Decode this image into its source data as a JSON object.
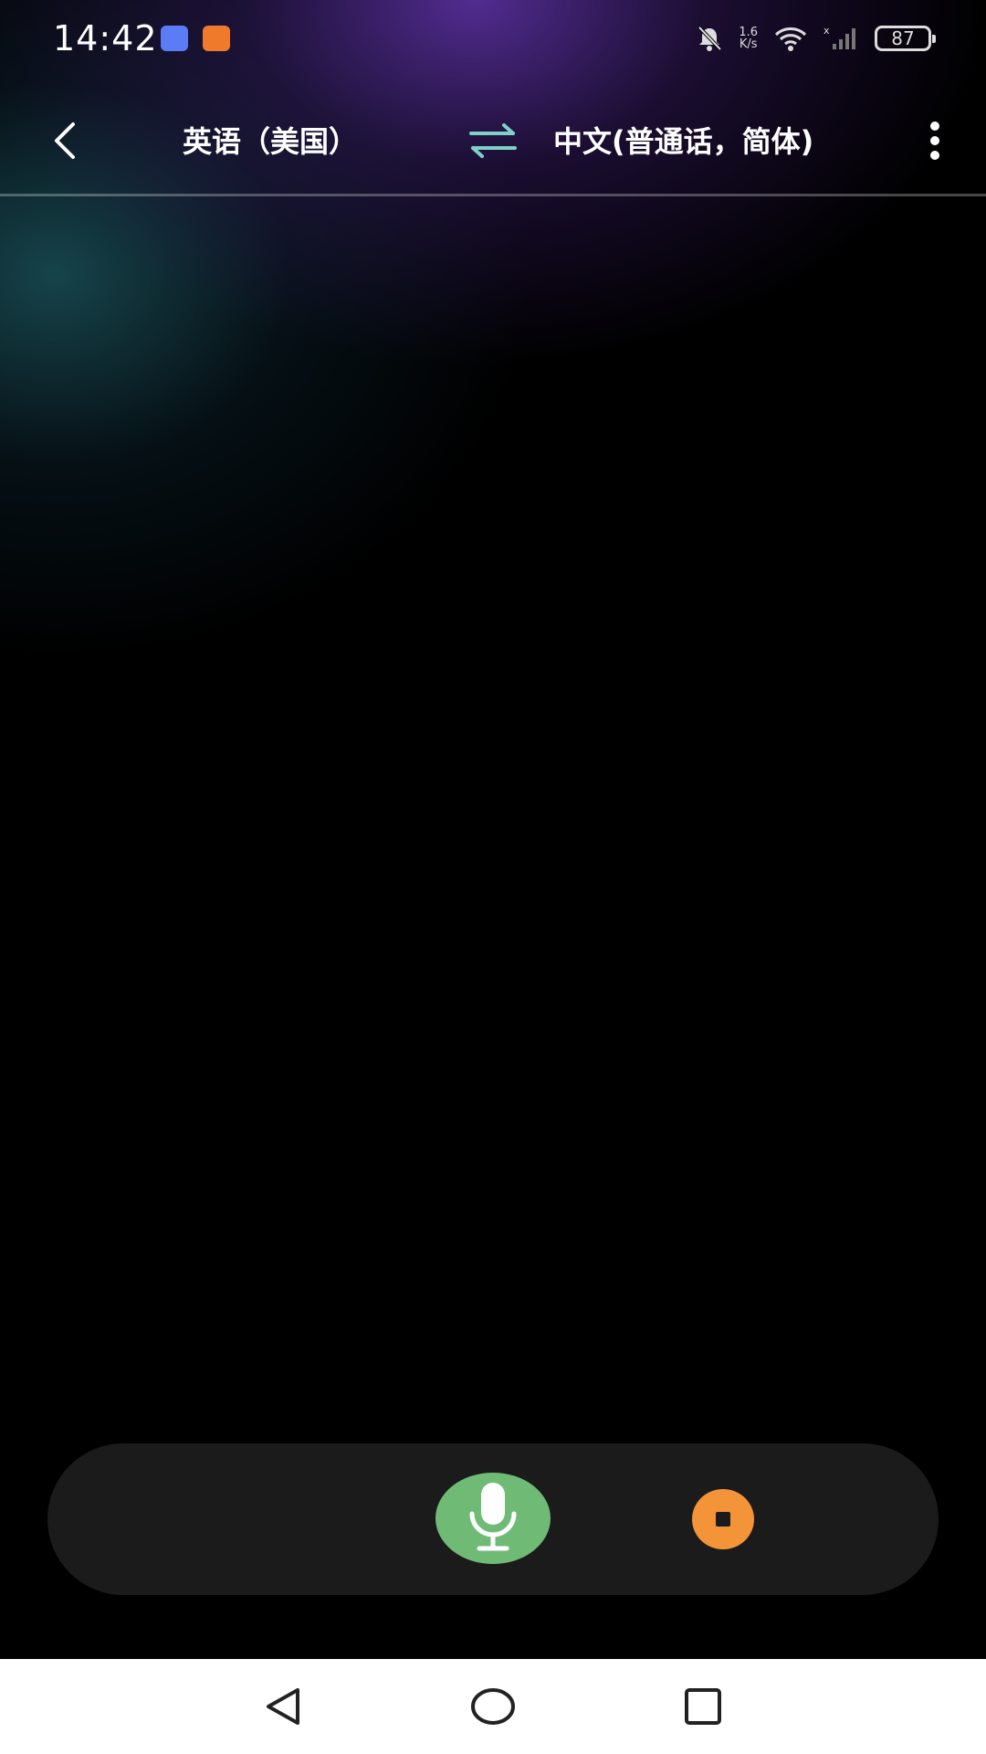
{
  "status_bar": {
    "time": "14:42",
    "net_speed_value": "1.6",
    "net_speed_unit": "K/s",
    "battery": "87",
    "icons": [
      "phone-app-icon",
      "video-app-icon",
      "mute-bell-icon",
      "wifi-icon",
      "signal-icon",
      "battery-icon"
    ]
  },
  "top_nav": {
    "source_language": "英语（美国）",
    "target_language": "中文(普通话，简体)",
    "icons": [
      "back-icon",
      "swap-icon",
      "more-vertical-icon"
    ]
  },
  "controls": {
    "icons": [
      "microphone-icon",
      "stop-icon"
    ]
  },
  "colors": {
    "mic_button": "#6fbb75",
    "stop_button": "#f29437",
    "control_bar": "#1b1b1b",
    "swap_accent": "#7fd0c8"
  },
  "system_nav": {
    "icons": [
      "nav-back-icon",
      "nav-home-icon",
      "nav-recent-icon"
    ]
  }
}
